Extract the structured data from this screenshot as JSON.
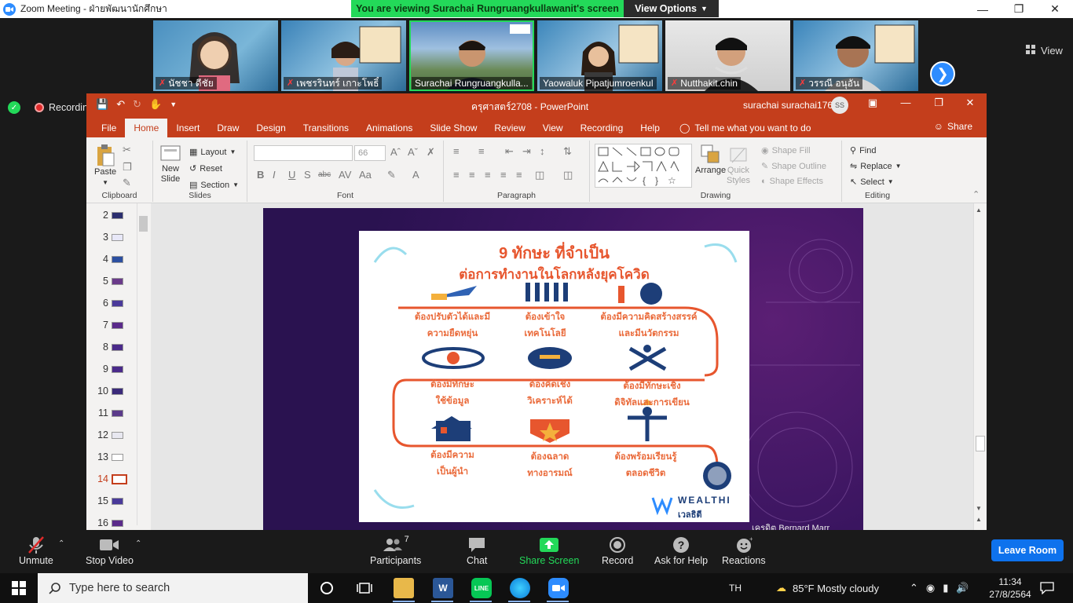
{
  "zoom": {
    "window_title": "Zoom Meeting - ฝ่ายพัฒนานักศึกษา",
    "viewing_banner": "You are viewing Surachai Rungruangkullawanit's screen",
    "view_options": "View Options",
    "view_label": "View",
    "recording_label": "Recording"
  },
  "participants_strip": [
    {
      "name": "นัชชา ดีชัย",
      "muted": true,
      "active": false
    },
    {
      "name": "เพชรรินทร์ เกาะโพธิ์",
      "muted": true,
      "active": false
    },
    {
      "name": "Surachai Rungruangkulla...",
      "muted": false,
      "active": true
    },
    {
      "name": "Yaowaluk Pipatjumroenkul",
      "muted": false,
      "active": false
    },
    {
      "name": "Nutthakit.chin",
      "muted": true,
      "active": false
    },
    {
      "name": "วรรณี อนุอัน",
      "muted": true,
      "active": false
    }
  ],
  "ppt": {
    "doc_title": "ครุศาสตร์2708  -  PowerPoint",
    "user_name": "surachai surachai1769",
    "user_initials": "SS",
    "tabs": [
      "File",
      "Home",
      "Insert",
      "Draw",
      "Design",
      "Transitions",
      "Animations",
      "Slide Show",
      "Review",
      "View",
      "Recording",
      "Help"
    ],
    "active_tab": "Home",
    "tell_me": "Tell me what you want to do",
    "share": "Share",
    "ribbon": {
      "paste": "Paste",
      "clipboard": "Clipboard",
      "new_slide_1": "New",
      "new_slide_2": "Slide",
      "layout": "Layout",
      "reset": "Reset",
      "section": "Section",
      "slides": "Slides",
      "font_size": "66",
      "font": "Font",
      "paragraph": "Paragraph",
      "arrange": "Arrange",
      "quick_styles_1": "Quick",
      "quick_styles_2": "Styles",
      "shape_fill": "Shape Fill",
      "shape_outline": "Shape Outline",
      "shape_effects": "Shape Effects",
      "drawing": "Drawing",
      "find": "Find",
      "replace": "Replace",
      "select": "Select",
      "editing": "Editing"
    },
    "slide_numbers": [
      "2",
      "3",
      "4",
      "5",
      "6",
      "7",
      "8",
      "9",
      "10",
      "11",
      "12",
      "13",
      "14",
      "15",
      "16"
    ],
    "active_slide": "14",
    "slide": {
      "title_1": "9 ทักษะ ที่จำเป็น",
      "title_2": "ต่อการทำงานในโลกหลังยุคโควิด",
      "skills": [
        [
          "ต้องปรับตัวได้และมี",
          "ความยืดหยุ่น"
        ],
        [
          "ต้องเข้าใจ",
          "เทคโนโลยี"
        ],
        [
          "ต้องมีความคิดสร้างสรรค์",
          "และมีนวัตกรรม"
        ],
        [
          "ต้องมีทักษะ",
          "ใช้ข้อมูล"
        ],
        [
          "ต้องคิดเชิง",
          "วิเคราะห์ได้"
        ],
        [
          "ต้องมีทักษะเชิง",
          "ดิจิทัลและการเขียน"
        ],
        [
          "ต้องมีความ",
          "เป็นผู้นำ"
        ],
        [
          "ต้องฉลาด",
          "ทางอารมณ์"
        ],
        [
          "ต้องพร้อมเรียนรู้",
          "ตลอดชีวิต"
        ]
      ],
      "brand_1": "WEALTHI",
      "brand_2": "เวลธิตี",
      "credit": "เครดิต Bernard Marr"
    }
  },
  "toolbar": {
    "unmute": "Unmute",
    "stop_video": "Stop Video",
    "participants": "Participants",
    "participants_count": "7",
    "chat": "Chat",
    "share_screen": "Share Screen",
    "record": "Record",
    "ask_help": "Ask for Help",
    "reactions": "Reactions",
    "leave": "Leave Room"
  },
  "taskbar": {
    "search_placeholder": "Type here to search",
    "lang": "TH",
    "weather": "85°F  Mostly cloudy",
    "time": "11:34",
    "date": "27/8/2564"
  },
  "colors": {
    "zoom_green": "#23d959",
    "ppt_red": "#c43e1c",
    "zoom_blue": "#0e72ed",
    "poster_orange": "#e7562e"
  }
}
